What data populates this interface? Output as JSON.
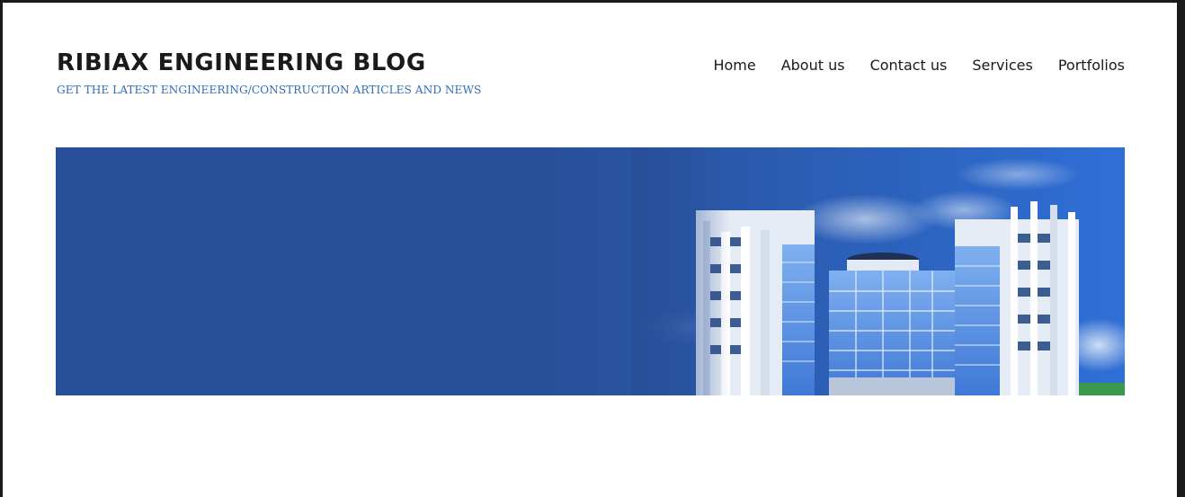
{
  "site": {
    "title": "RIBIAX ENGINEERING BLOG",
    "description": "GET THE LATEST ENGINEERING/CONSTRUCTION ARTICLES AND NEWS"
  },
  "nav": {
    "items": [
      {
        "label": "Home"
      },
      {
        "label": "About us"
      },
      {
        "label": "Contact us"
      },
      {
        "label": "Services"
      },
      {
        "label": "Portfolios"
      }
    ]
  },
  "header_image": {
    "subject": "modern-office-building-render",
    "colors": {
      "primary_blue": "#284f99",
      "sky": "#2f6fd6",
      "glass": "#4a86e0",
      "tagline": "#2f6dbb"
    }
  }
}
